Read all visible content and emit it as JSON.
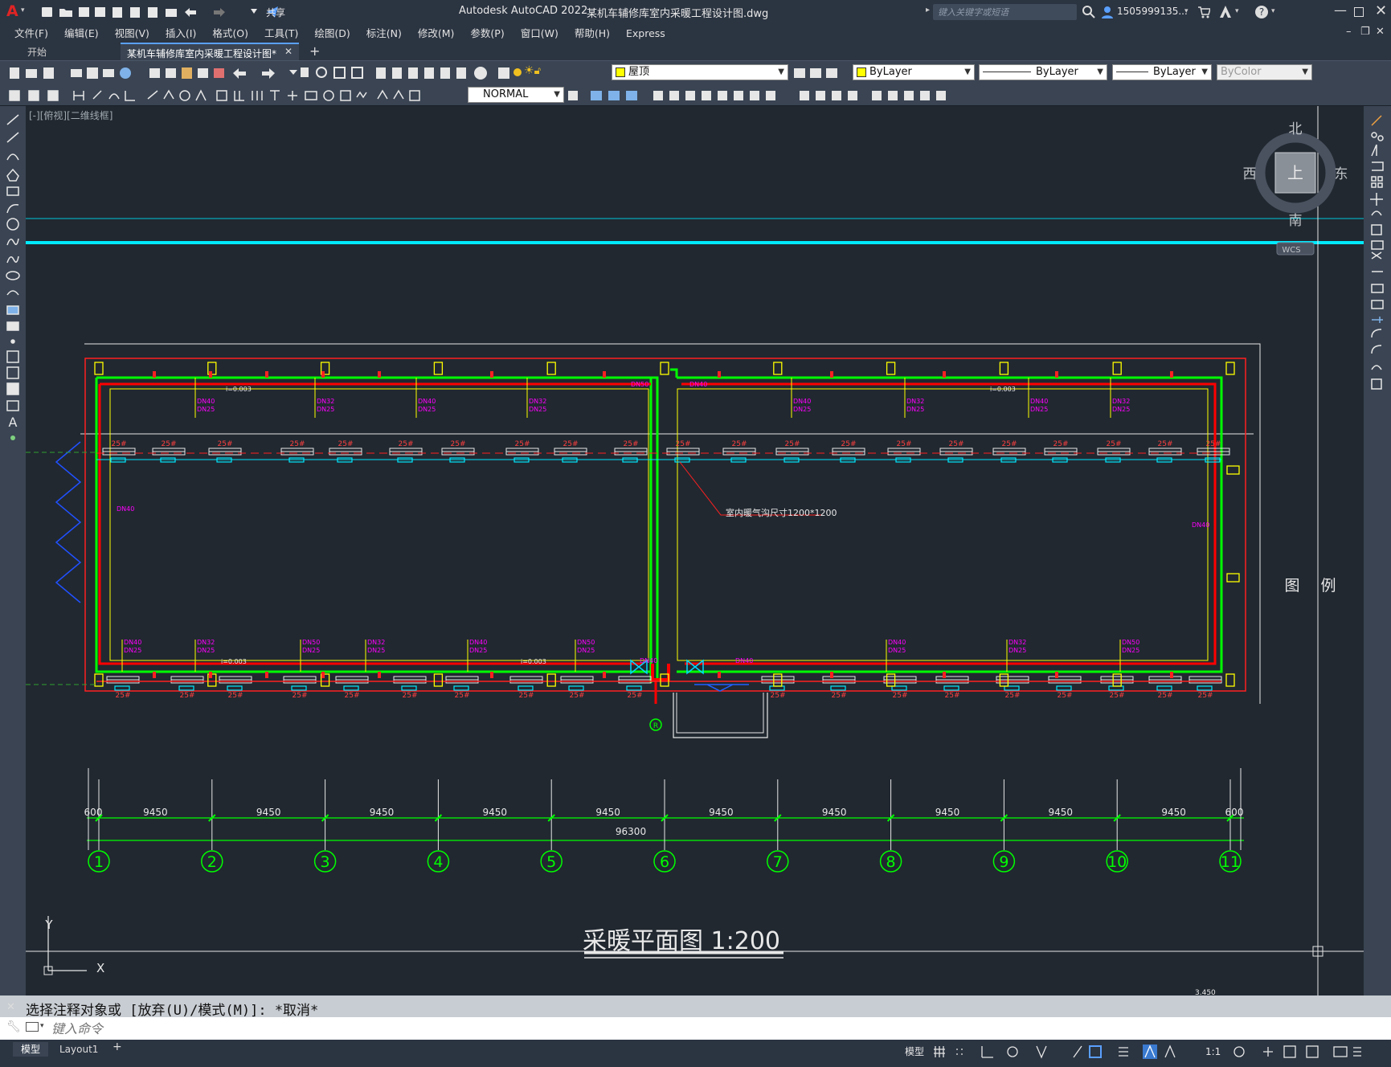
{
  "app": {
    "title": "Autodesk AutoCAD 2022",
    "filename": "某机车辅修库室内采暖工程设计图.dwg",
    "share": "共享",
    "search_placeholder": "键入关键字或短语",
    "user": "1505999135...",
    "logo": "A"
  },
  "menu": [
    "文件(F)",
    "编辑(E)",
    "视图(V)",
    "插入(I)",
    "格式(O)",
    "工具(T)",
    "绘图(D)",
    "标注(N)",
    "修改(M)",
    "参数(P)",
    "窗口(W)",
    "帮助(H)",
    "Express"
  ],
  "tabs": [
    {
      "label": "开始"
    },
    {
      "label": "某机车辅修库室内采暖工程设计图*"
    }
  ],
  "toolbar": {
    "layer": "屋顶",
    "color": "ByLayer",
    "linetype": "ByLayer",
    "lineweight": "ByLayer",
    "plotstyle": "ByColor",
    "textstyle": "NORMAL"
  },
  "viewport": {
    "label": "[-][俯视][二维线框]"
  },
  "viewcube": {
    "n": "北",
    "s": "南",
    "e": "东",
    "w": "西",
    "top": "上",
    "wcs": "WCS"
  },
  "drawing": {
    "title": "采暖平面图 1:200",
    "legend": [
      "图",
      "例"
    ],
    "total_dim": "96300",
    "dims": [
      "600",
      "9450",
      "9450",
      "9450",
      "9450",
      "9450",
      "9450",
      "9450",
      "9450",
      "9450",
      "9450",
      "600"
    ],
    "axes": [
      "1",
      "2",
      "3",
      "4",
      "5",
      "6",
      "7",
      "8",
      "9",
      "10",
      "11"
    ],
    "note": "室内暖气沟尺寸1200*1200",
    "ucs_x": "X",
    "ucs_y": "Y",
    "elev": "3.450",
    "valve_label": "R",
    "rad_label": "25#",
    "pipe_top": [
      "DN50",
      "DN40"
    ],
    "pipe_mid": "DN40",
    "slope": "i=0.003",
    "dn_labels": [
      "DN40",
      "DN32",
      "DN25",
      "DN50"
    ]
  },
  "command": {
    "history": "选择注释对象或 [放弃(U)/模式(M)]: *取消*",
    "placeholder": "键入命令"
  },
  "status": {
    "model_tab": "模型",
    "layout_tab": "Layout1",
    "model_btn": "模型",
    "scale": "1:1"
  },
  "colors": {
    "bg": "#212830",
    "green": "#00ff00",
    "red": "#ff0000",
    "cyan": "#00ffff",
    "yellow": "#ffff00",
    "magenta": "#ff00ff"
  }
}
